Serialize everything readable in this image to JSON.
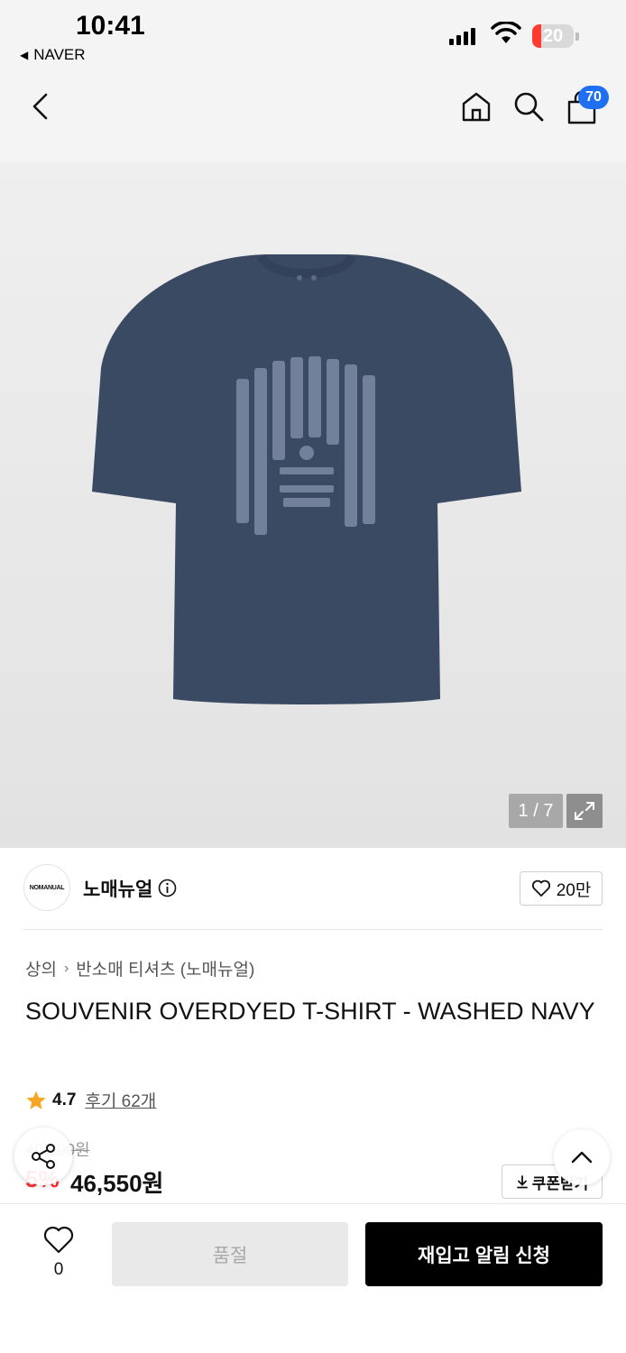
{
  "status_bar": {
    "time": "10:41",
    "back_app": "NAVER",
    "battery": "20"
  },
  "nav": {
    "cart_count": "70"
  },
  "gallery": {
    "counter": "1 / 7"
  },
  "brand": {
    "logo_text": "NOMANUAL",
    "name": "노매뉴얼",
    "likes": "20만"
  },
  "breadcrumb": [
    "상의",
    "반소매 티셔츠 (노매뉴얼)"
  ],
  "product": {
    "title": "SOUVENIR OVERDYED T-SHIRT - WASHED NAVY",
    "rating": "4.7",
    "reviews": "후기 62개",
    "original_price": "49,000원",
    "discount": "5%",
    "price": "46,550원",
    "coupon_label": "쿠폰받기"
  },
  "bottom": {
    "wish_count": "0",
    "soldout_label": "품절",
    "restock_label": "재입고 알림 신청"
  },
  "colors": {
    "accent_blue": "#1f6ff2",
    "discount_red": "#ff2d2d",
    "shirt_navy": "#3b4a63"
  }
}
